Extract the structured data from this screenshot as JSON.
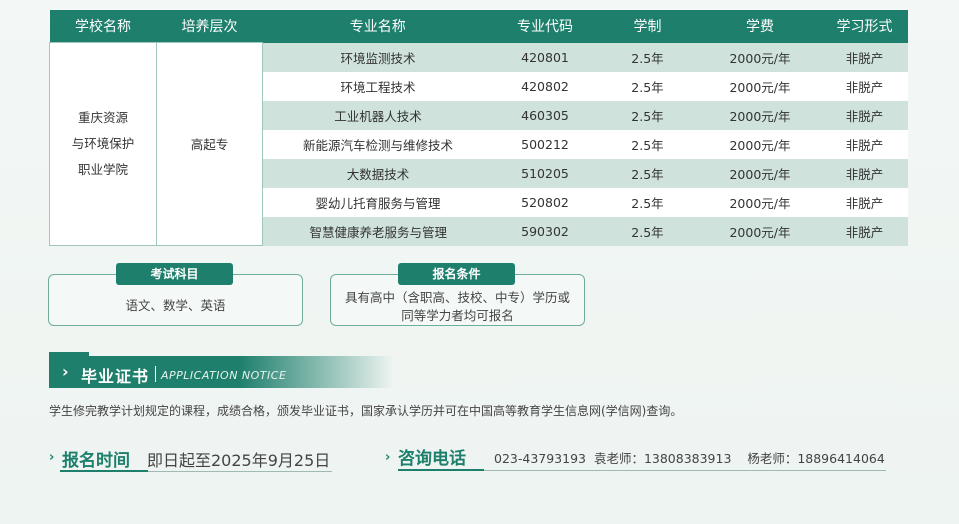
{
  "table": {
    "headers": [
      "学校名称",
      "培养层次",
      "专业名称",
      "专业代码",
      "学制",
      "学费",
      "学习形式"
    ],
    "school": [
      "重庆资源",
      "与环境保护",
      "职业学院"
    ],
    "level": "高起专",
    "rows": [
      {
        "major": "环境监测技术",
        "code": "420801",
        "years": "2.5年",
        "fee": "2000元/年",
        "mode": "非脱产"
      },
      {
        "major": "环境工程技术",
        "code": "420802",
        "years": "2.5年",
        "fee": "2000元/年",
        "mode": "非脱产"
      },
      {
        "major": "工业机器人技术",
        "code": "460305",
        "years": "2.5年",
        "fee": "2000元/年",
        "mode": "非脱产"
      },
      {
        "major": "新能源汽车检测与维修技术",
        "code": "500212",
        "years": "2.5年",
        "fee": "2000元/年",
        "mode": "非脱产"
      },
      {
        "major": "大数据技术",
        "code": "510205",
        "years": "2.5年",
        "fee": "2000元/年",
        "mode": "非脱产"
      },
      {
        "major": "婴幼儿托育服务与管理",
        "code": "520802",
        "years": "2.5年",
        "fee": "2000元/年",
        "mode": "非脱产"
      },
      {
        "major": "智慧健康养老服务与管理",
        "code": "590302",
        "years": "2.5年",
        "fee": "2000元/年",
        "mode": "非脱产"
      }
    ]
  },
  "exam": {
    "title": "考试科目",
    "text": "语文、数学、英语"
  },
  "conditions": {
    "title": "报名条件",
    "line1": "具有高中（含职高、技校、中专）学历或",
    "line2": "同等学力者均可报名"
  },
  "certificate": {
    "title": "毕业证书",
    "subtitle": "APPLICATION NOTICE",
    "notice": "学生修完教学计划规定的课程，成绩合格，颁发毕业证书，国家承认学历并可在中国高等教育学生信息网(学信网)查询。"
  },
  "registration": {
    "label": "报名时间",
    "value": "即日起至2025年9月25日"
  },
  "contact": {
    "label": "咨询电话",
    "value": "023-43793193  袁老师：13808383913    杨老师：18896414064"
  },
  "colors": {
    "accent": "#1e7f6c",
    "row_alt": "#cfe2db"
  }
}
